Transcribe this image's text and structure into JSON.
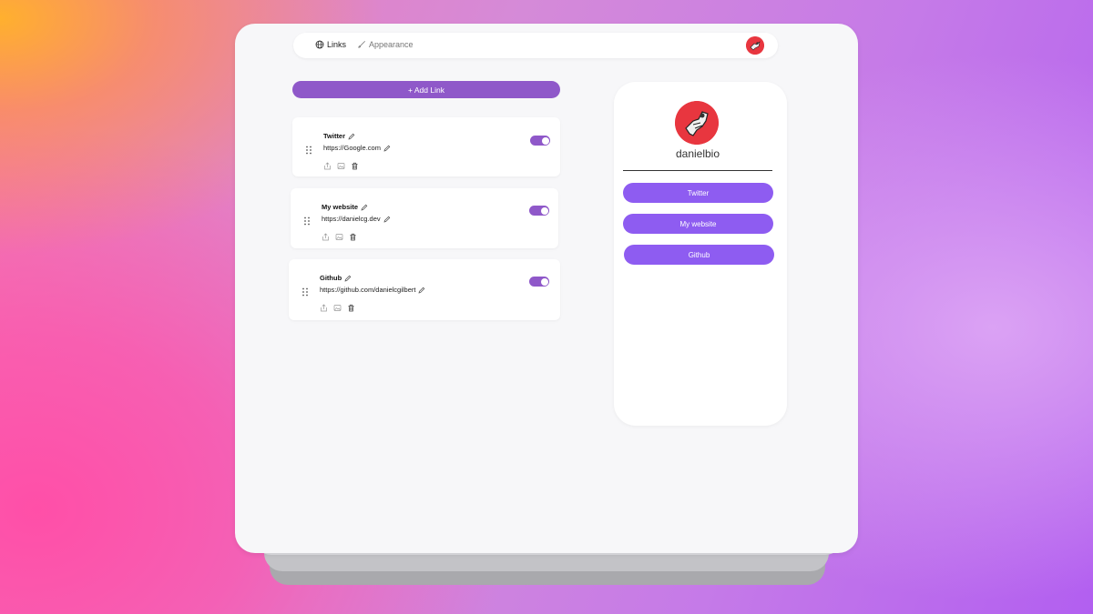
{
  "nav": {
    "links_label": "Links",
    "appearance_label": "Appearance"
  },
  "add_link_label": "+ Add Link",
  "links": [
    {
      "title": "Twitter",
      "url": "https://Google.com",
      "enabled": true
    },
    {
      "title": "My website",
      "url": "https://danielcg.dev",
      "enabled": true
    },
    {
      "title": "Github",
      "url": "https://github.com/danielcgilbert",
      "enabled": true
    }
  ],
  "preview": {
    "username": "danielbio",
    "buttons": [
      "Twitter",
      "My website",
      "Github"
    ]
  },
  "icons": {
    "nav_links": "globe-icon",
    "nav_appearance": "brush-icon",
    "edit": "pencil-icon",
    "drag": "drag-handle-icon",
    "share": "share-icon",
    "image": "image-icon",
    "delete": "trash-icon"
  },
  "colors": {
    "accent": "#8f58c9",
    "preview_button": "#8e5cf1",
    "avatar": "#e8363f"
  }
}
